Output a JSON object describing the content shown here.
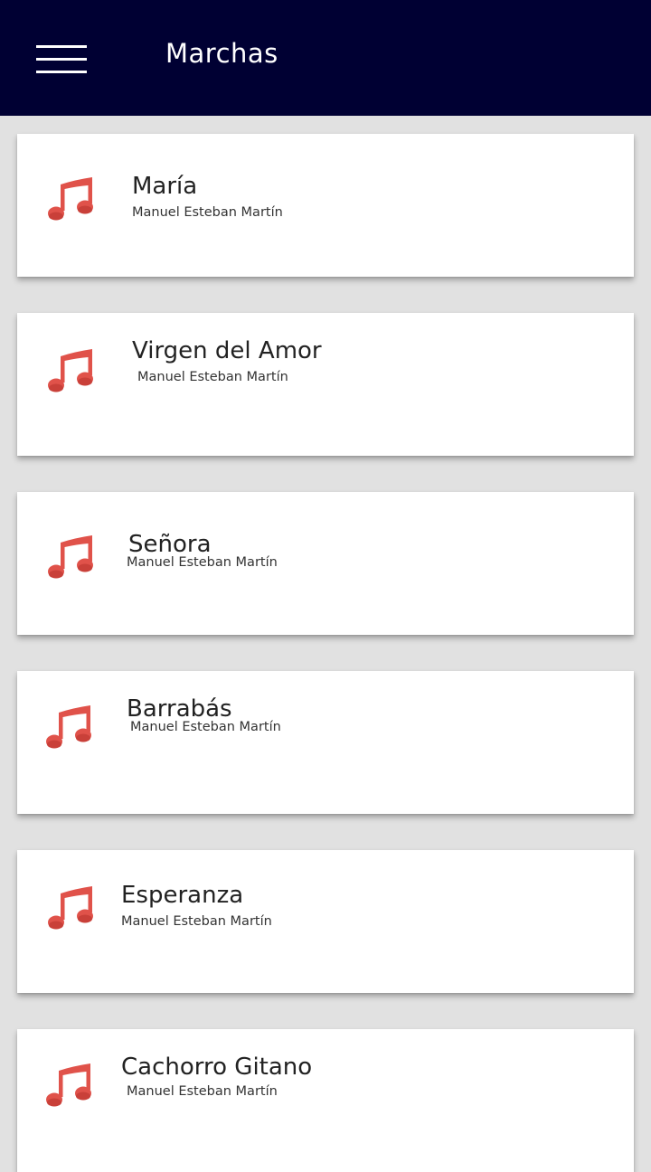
{
  "app_bar": {
    "title": "Marchas",
    "menu_icon": "hamburger-menu-icon",
    "background": "#000033"
  },
  "items": [
    {
      "title": "María",
      "subtitle": "Manuel Esteban Martín",
      "icon": "music-note-icon"
    },
    {
      "title": "Virgen del Amor",
      "subtitle": "Manuel Esteban Martín",
      "icon": "music-note-icon"
    },
    {
      "title": "Señora",
      "subtitle": "Manuel Esteban Martín",
      "icon": "music-note-icon"
    },
    {
      "title": "Barrabás",
      "subtitle": "Manuel Esteban Martín",
      "icon": "music-note-icon"
    },
    {
      "title": "Esperanza",
      "subtitle": "Manuel Esteban Martín",
      "icon": "music-note-icon"
    },
    {
      "title": "Cachorro Gitano",
      "subtitle": "Manuel Esteban Martín",
      "icon": "music-note-icon"
    }
  ],
  "colors": {
    "accent_note": "#e0524a",
    "background": "#e1e1e1",
    "card": "#ffffff"
  }
}
